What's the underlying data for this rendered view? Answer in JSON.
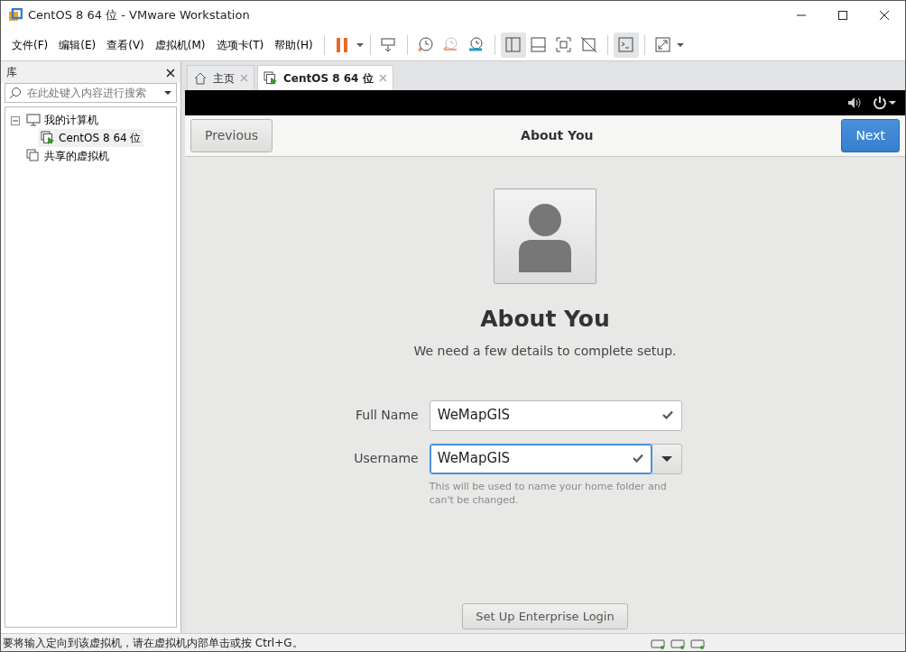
{
  "window": {
    "title": "CentOS 8 64 位 - VMware Workstation"
  },
  "menu": [
    "文件(F)",
    "编辑(E)",
    "查看(V)",
    "虚拟机(M)",
    "选项卡(T)",
    "帮助(H)"
  ],
  "toolbar": [
    {
      "kind": "pause",
      "selected": false
    },
    {
      "kind": "send-keys",
      "selected": false
    },
    {
      "kind": "snapshot",
      "selected": false
    },
    {
      "kind": "revert",
      "selected": false
    },
    {
      "kind": "snapshot-manager",
      "selected": false
    },
    {
      "kind": "library-view",
      "selected": true
    },
    {
      "kind": "thumbnail-view",
      "selected": false
    },
    {
      "kind": "full-screen",
      "selected": false
    },
    {
      "kind": "unity",
      "selected": false
    },
    {
      "kind": "console",
      "selected": true
    },
    {
      "kind": "stretch",
      "selected": false
    }
  ],
  "sidebar": {
    "title": "库",
    "search": {
      "placeholder": "在此处键入内容进行搜索"
    },
    "tree": [
      {
        "label": "我的计算机",
        "kind": "computer",
        "expanded": true,
        "selected": false,
        "children": [
          {
            "label": "CentOS 8 64 位",
            "kind": "vm",
            "selected": true
          }
        ]
      },
      {
        "label": "共享的虚拟机",
        "kind": "shared",
        "selected": false
      }
    ]
  },
  "tabs": [
    {
      "label": "主页",
      "kind": "home",
      "selected": false
    },
    {
      "label": "CentOS 8 64 位",
      "kind": "vm",
      "selected": true
    }
  ],
  "setup": {
    "header": {
      "previous": "Previous",
      "title": "About You",
      "next": "Next"
    },
    "heading": "About You",
    "subtitle": "We need a few details to complete setup.",
    "fields": [
      {
        "label": "Full Name",
        "value": "WeMapGIS",
        "valid": true,
        "focused": false,
        "dropdown": false
      },
      {
        "label": "Username",
        "value": "WeMapGIS",
        "valid": true,
        "focused": true,
        "dropdown": true
      }
    ],
    "hint": "This will be used to name your home folder and can't be changed.",
    "enterprise_button": "Set Up Enterprise Login"
  },
  "status_bar": "要将输入定向到该虚拟机，请在虚拟机内部单击或按 Ctrl+G。"
}
